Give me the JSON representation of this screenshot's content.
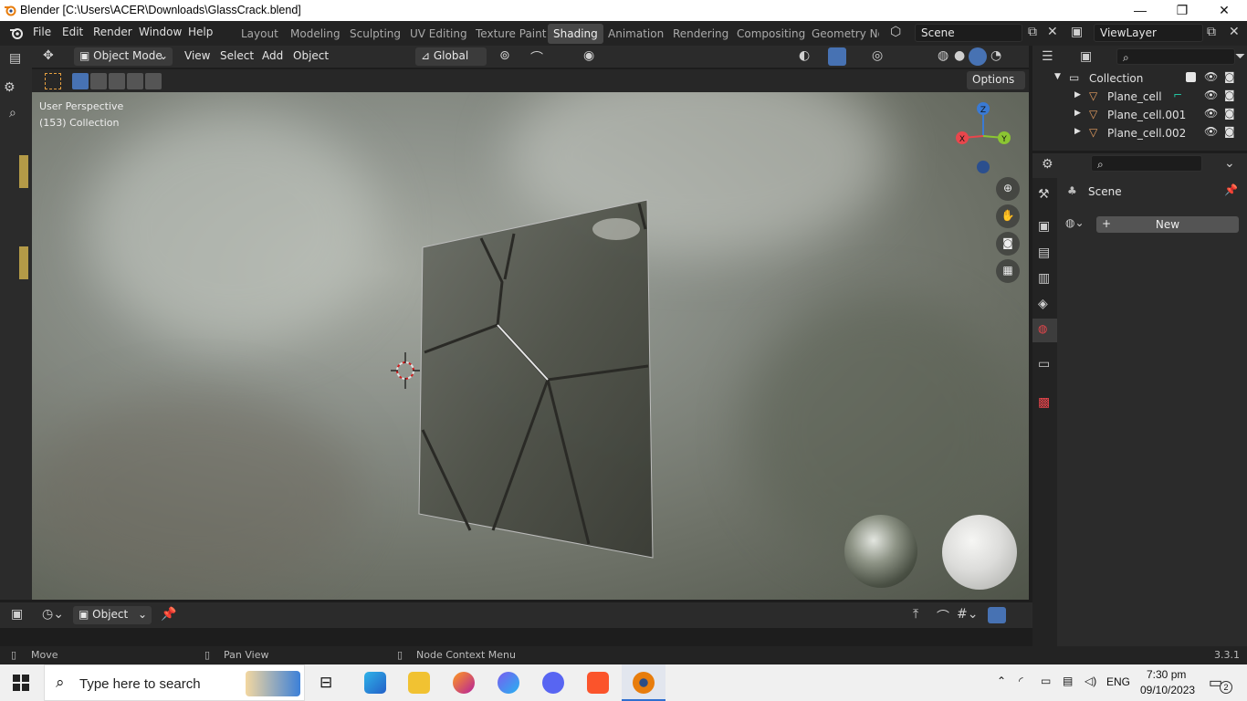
{
  "window": {
    "title": "Blender [C:\\Users\\ACER\\Downloads\\GlassCrack.blend]",
    "minimize": "—",
    "restore": "❐",
    "close": "✕"
  },
  "menu": [
    "File",
    "Edit",
    "Render",
    "Window",
    "Help"
  ],
  "workspaces": [
    {
      "label": "Layout",
      "active": false
    },
    {
      "label": "Modeling",
      "active": false
    },
    {
      "label": "Sculpting",
      "active": false
    },
    {
      "label": "UV Editing",
      "active": false
    },
    {
      "label": "Texture Paint",
      "active": false
    },
    {
      "label": "Shading",
      "active": true
    },
    {
      "label": "Animation",
      "active": false
    },
    {
      "label": "Rendering",
      "active": false
    },
    {
      "label": "Compositing",
      "active": false
    },
    {
      "label": "Geometry Noc",
      "active": false
    }
  ],
  "scene_field": "Scene",
  "viewlayer_field": "ViewLayer",
  "viewport_header": {
    "mode": "Object Mode",
    "view": "View",
    "select": "Select",
    "add": "Add",
    "object": "Object",
    "transform": "Global",
    "options": "Options"
  },
  "viewport_overlay": {
    "perspective": "User Perspective",
    "collection": "(153) Collection",
    "gizmo_z": "Z",
    "gizmo_x": "X",
    "gizmo_y": "Y"
  },
  "outliner": {
    "collection": "Collection",
    "items": [
      "Plane_cell",
      "Plane_cell.001",
      "Plane_cell.002"
    ]
  },
  "properties": {
    "scene_label": "Scene",
    "new_button": "New"
  },
  "bottom_header": {
    "mode": "Object"
  },
  "statusbar": {
    "move": "Move",
    "pan": "Pan View",
    "context": "Node Context Menu",
    "version": "3.3.1"
  },
  "taskbar": {
    "search_placeholder": "Type here to search",
    "lang": "ENG",
    "time": "7:30 pm",
    "date": "09/10/2023",
    "notifications": "2"
  },
  "colors": {
    "accent_blue": "#4772b3",
    "axis_x": "#e8464c",
    "axis_y": "#8bc532",
    "axis_z": "#3a7ad4"
  }
}
